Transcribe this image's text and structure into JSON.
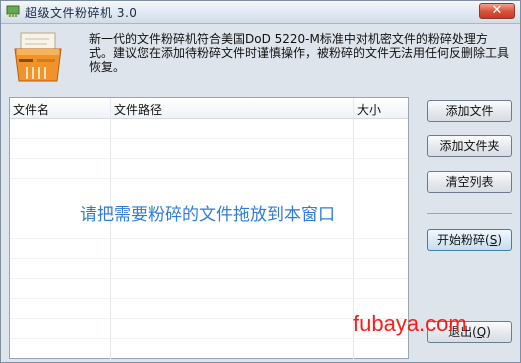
{
  "window": {
    "title": "超级文件粉碎机  3.0",
    "close_glyph": "✕"
  },
  "header": {
    "icon": "shredder-icon",
    "description": "新一代的文件粉碎机符合美国DoD 5220-M标准中对机密文件的粉碎处理方式。建议您在添加待粉碎文件时谨慎操作，被粉碎的文件无法用任何反删除工具恢复。"
  },
  "file_list": {
    "columns": [
      "文件名",
      "文件路径",
      "大小"
    ],
    "empty_hint": "请把需要粉碎的文件拖放到本窗口"
  },
  "buttons": {
    "add_file": "添加文件",
    "add_folder": "添加文件夹",
    "clear_list": "清空列表",
    "start_shred": "开始粉碎(",
    "start_shred_key": "S",
    "start_shred_end": ")",
    "exit": "退出(",
    "exit_key": "Q",
    "exit_end": ")"
  },
  "watermark": "fubaya.com",
  "colors": {
    "hint_blue": "#2f7cd7",
    "watermark_red": "#ff1a1a"
  }
}
